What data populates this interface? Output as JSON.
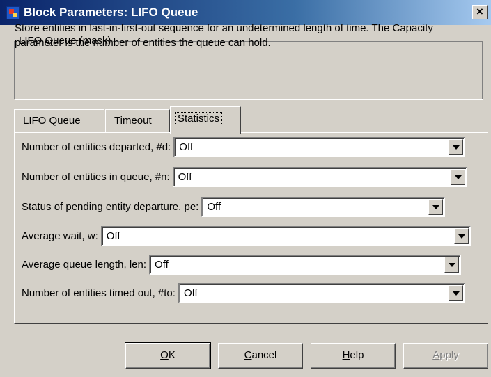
{
  "window": {
    "title": "Block Parameters: LIFO Queue",
    "close_glyph": "✕"
  },
  "mask": {
    "legend": "LIFO Queue (mask)",
    "description": "Store entities in last-in-first-out sequence for an undetermined length of time. The Capacity parameter is the number of entities the queue can hold."
  },
  "tabs": [
    {
      "label": "LIFO Queue",
      "active": false
    },
    {
      "label": "Timeout",
      "active": false
    },
    {
      "label": "Statistics",
      "active": true
    }
  ],
  "statistics": [
    {
      "label": "Number of entities departed, #d:",
      "value": "Off"
    },
    {
      "label": "Number of entities in queue, #n:",
      "value": "Off"
    },
    {
      "label": "Status of pending entity departure, pe:",
      "value": "Off"
    },
    {
      "label": "Average wait, w:",
      "value": "Off"
    },
    {
      "label": "Average queue length, len:",
      "value": "Off"
    },
    {
      "label": "Number of entities timed out, #to:",
      "value": "Off"
    }
  ],
  "buttons": {
    "ok": {
      "mnemonic": "O",
      "rest": "K"
    },
    "cancel": {
      "mnemonic": "C",
      "rest": "ancel"
    },
    "help": {
      "mnemonic": "H",
      "rest": "elp"
    },
    "apply": {
      "mnemonic": "A",
      "rest": "pply",
      "enabled": false
    }
  },
  "colors": {
    "title_bar_start": "#0a246a",
    "title_bar_end": "#a6caf0",
    "dialog_face": "#d4d0c8",
    "disabled_text": "#808080"
  }
}
